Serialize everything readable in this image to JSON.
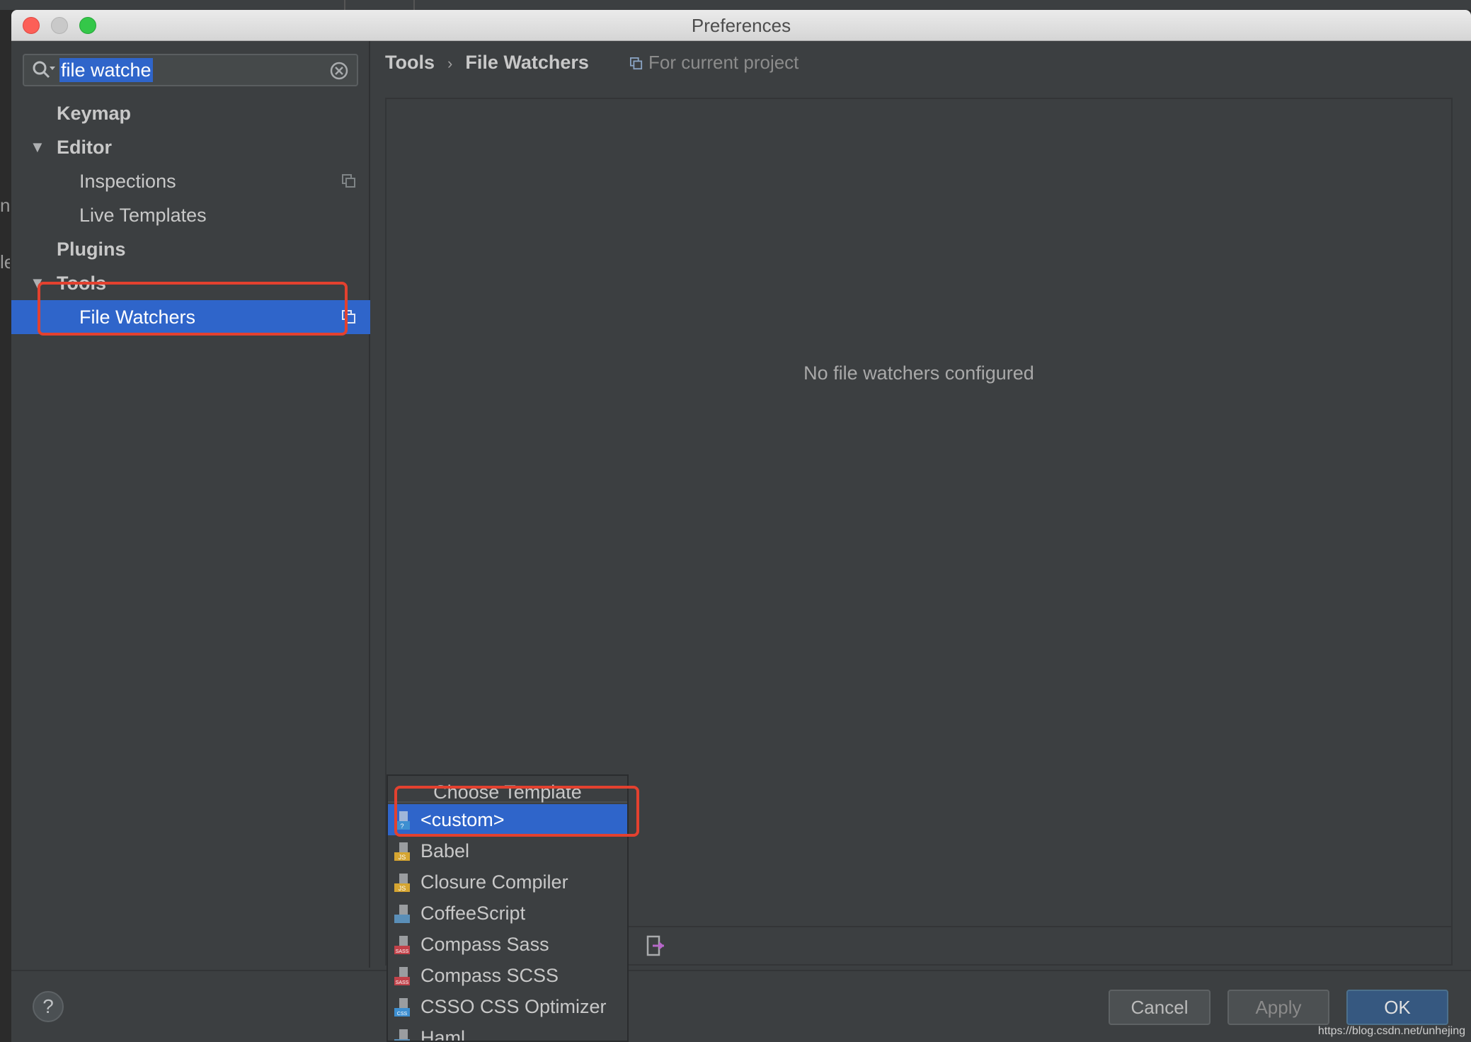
{
  "window": {
    "title": "Preferences"
  },
  "background": {
    "left_letters": [
      "n",
      "le"
    ]
  },
  "search": {
    "value": "file watche",
    "placeholder": ""
  },
  "tree": [
    {
      "label": "Keymap",
      "bold": true,
      "expanded": null,
      "selected": false,
      "project_icon": false
    },
    {
      "label": "Editor",
      "bold": true,
      "expanded": true,
      "selected": false,
      "project_icon": false
    },
    {
      "label": "Inspections",
      "bold": false,
      "expanded": null,
      "selected": false,
      "project_icon": true
    },
    {
      "label": "Live Templates",
      "bold": false,
      "expanded": null,
      "selected": false,
      "project_icon": false
    },
    {
      "label": "Plugins",
      "bold": true,
      "expanded": null,
      "selected": false,
      "project_icon": false
    },
    {
      "label": "Tools",
      "bold": true,
      "expanded": true,
      "selected": false,
      "project_icon": false
    },
    {
      "label": "File Watchers",
      "bold": false,
      "expanded": null,
      "selected": true,
      "project_icon": true
    }
  ],
  "breadcrumb": {
    "parent": "Tools",
    "separator": "›",
    "current": "File Watchers"
  },
  "scope_label": "For current project",
  "content": {
    "empty_text": "No file watchers configured"
  },
  "template_popup": {
    "title": "Choose Template",
    "items": [
      {
        "label": "<custom>",
        "icon": "custom-file-icon",
        "selected": true,
        "badge": "?"
      },
      {
        "label": "Babel",
        "icon": "js-file-icon",
        "selected": false,
        "badge": "JS"
      },
      {
        "label": "Closure Compiler",
        "icon": "js-file-icon",
        "selected": false,
        "badge": "JS"
      },
      {
        "label": "CoffeeScript",
        "icon": "coffee-file-icon",
        "selected": false,
        "badge": ""
      },
      {
        "label": "Compass Sass",
        "icon": "sass-file-icon",
        "selected": false,
        "badge": "SASS"
      },
      {
        "label": "Compass SCSS",
        "icon": "sass-file-icon",
        "selected": false,
        "badge": "SASS"
      },
      {
        "label": "CSSO CSS Optimizer",
        "icon": "css-file-icon",
        "selected": false,
        "badge": "CSS"
      },
      {
        "label": "Haml",
        "icon": "haml-file-icon",
        "selected": false,
        "badge": ""
      }
    ]
  },
  "buttons": {
    "help": "?",
    "cancel": "Cancel",
    "apply": "Apply",
    "ok": "OK"
  },
  "watermark": "https://blog.csdn.net/unhejing",
  "colors": {
    "selection": "#2f65ca",
    "annotation": "#e3412f",
    "panel": "#3c3f41",
    "ok_button": "#365880"
  }
}
